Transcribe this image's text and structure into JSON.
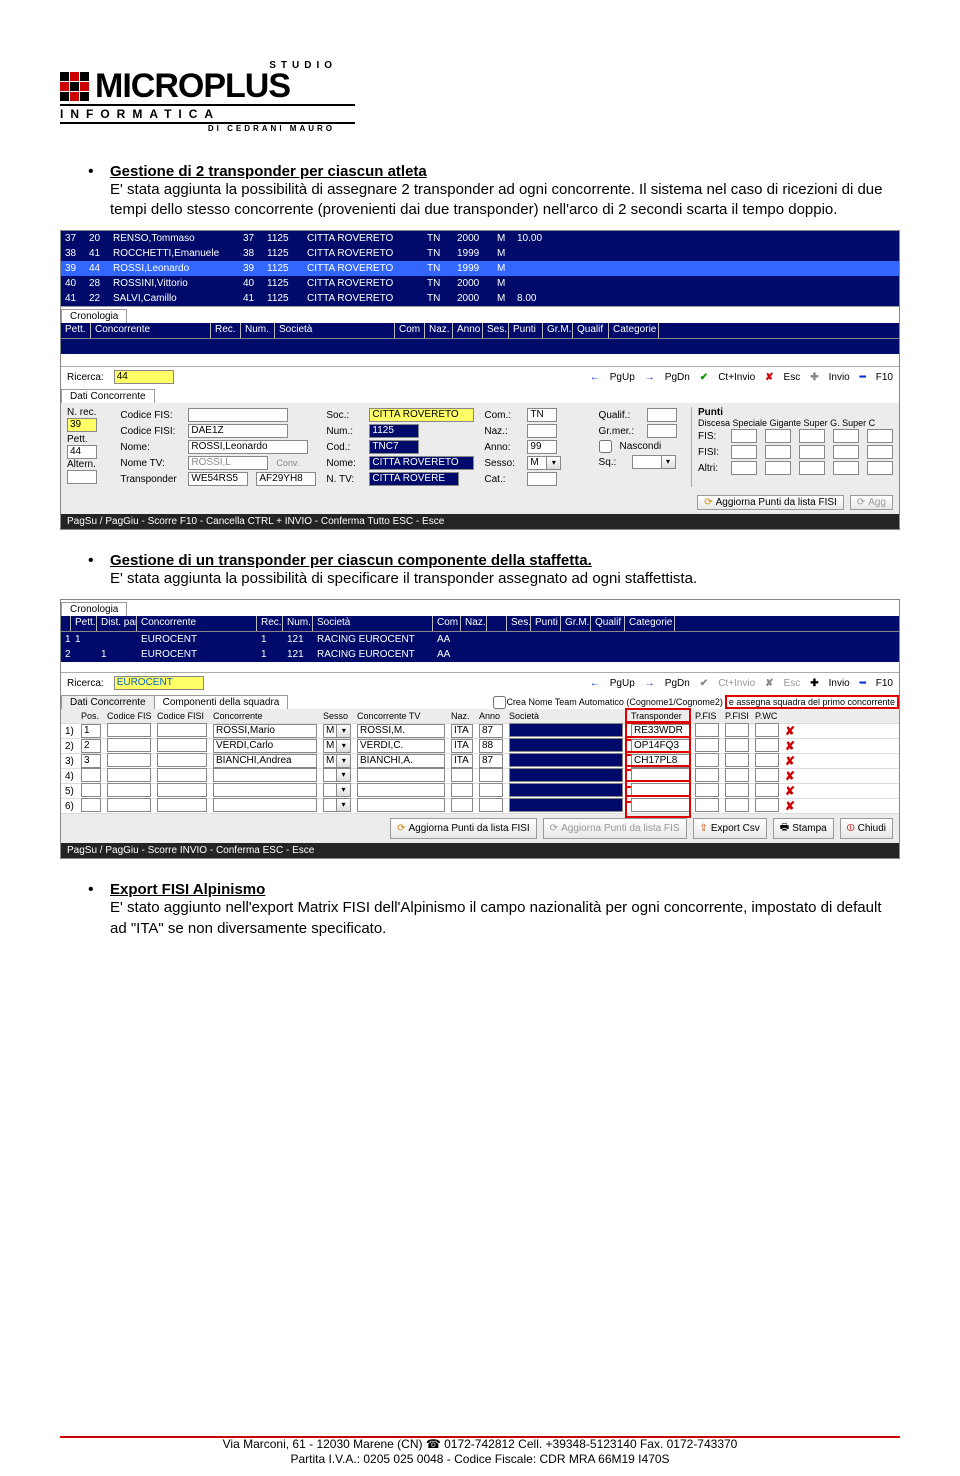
{
  "logo": {
    "studio": "STUDIO",
    "brand": "MICROPLUS",
    "sub1": "INFORMATICA",
    "sub2": "DI CEDRANI MAURO"
  },
  "sections": [
    {
      "title": "Gestione di 2 transponder per ciascun atleta",
      "body": "E' stata aggiunta la possibilità di assegnare 2 transponder ad ogni concorrente. Il sistema nel caso di ricezioni di due tempi dello stesso concorrente (provenienti dai due transponder) nell'arco di 2 secondi scarta il tempo doppio."
    },
    {
      "title": "Gestione di un transponder per ciascun componente della staffetta.",
      "body": "E' stata aggiunta la possibilità di specificare il transponder assegnato ad ogni staffettista."
    },
    {
      "title": "Export FISI Alpinismo",
      "body": "E' stato aggiunto nell'export Matrix FISI dell'Alpinismo il campo nazionalità per ogni concorrente, impostato di default ad \"ITA\" se non diversamente specificato."
    }
  ],
  "shot1": {
    "rows": [
      {
        "c": [
          "37",
          "20",
          "RENSO,Tommaso",
          "37",
          "1125",
          "CITTA ROVERETO",
          "TN",
          "2000",
          "M",
          "10.00"
        ],
        "sel": false
      },
      {
        "c": [
          "38",
          "41",
          "ROCCHETTI,Emanuele",
          "38",
          "1125",
          "CITTA ROVERETO",
          "TN",
          "1999",
          "M",
          ""
        ],
        "sel": false
      },
      {
        "c": [
          "39",
          "44",
          "ROSSI,Leonardo",
          "39",
          "1125",
          "CITTA ROVERETO",
          "TN",
          "1999",
          "M",
          ""
        ],
        "sel": true
      },
      {
        "c": [
          "40",
          "28",
          "ROSSINI,Vittorio",
          "40",
          "1125",
          "CITTA ROVERETO",
          "TN",
          "2000",
          "M",
          ""
        ],
        "sel": false
      },
      {
        "c": [
          "41",
          "22",
          "SALVI,Camillo",
          "41",
          "1125",
          "CITTA ROVERETO",
          "TN",
          "2000",
          "M",
          "8.00"
        ],
        "sel": false
      }
    ],
    "cronologia_tab": "Cronologia",
    "cronologia_headers": [
      "Pett.",
      "Concorrente",
      "Rec.",
      "Num.",
      "Società",
      "Com",
      "Naz.",
      "Anno",
      "Ses.",
      "Punti",
      "Gr.M.",
      "Qualif",
      "Categorie"
    ],
    "ricerca_label": "Ricerca:",
    "ricerca_value": "44",
    "nav": {
      "pgup": "PgUp",
      "pgdn": "PgDn",
      "ctinvio": "Ct+Invio",
      "esc": "Esc",
      "invio": "Invio",
      "f10": "F10"
    },
    "dati_tab": "Dati Concorrente",
    "form": {
      "nrec_label": "N. rec.",
      "nrec": "39",
      "pett_label": "Pett.",
      "pett": "44",
      "altern_label": "Altern.",
      "codfis_label": "Codice FIS:",
      "codfisi_label": "Codice FISI:",
      "codfisi": "DAE1Z",
      "nome_label": "Nome:",
      "nome": "ROSSI,Leonardo",
      "nometv_label": "Nome TV:",
      "nometv": "ROSSI,L",
      "conv_label": "Conv.",
      "transp_label": "Transponder",
      "transp1": "WE54RS5",
      "transp2": "AF29YH8",
      "soc_label": "Soc.:",
      "soc": "CITTA ROVERETO",
      "num_label": "Num.:",
      "num": "1125",
      "cod_label": "Cod.:",
      "cod": "TNC7",
      "nome2_label": "Nome:",
      "nome2": "CITTA ROVERETO",
      "ntv_label": "N. TV:",
      "ntv": "CITTA ROVERE",
      "com_label": "Com.:",
      "com": "TN",
      "naz_label": "Naz.:",
      "anno_label": "Anno:",
      "anno": "99",
      "sesso_label": "Sesso:",
      "sesso": "M",
      "cat_label": "Cat.:",
      "qualif_label": "Qualif.:",
      "grmer_label": "Gr.mer.:",
      "nascondi_label": "Nascondi",
      "sq_label": "Sq.:",
      "punti_title": "Punti",
      "punti_cols": "Discesa Speciale Gigante Super G. Super C",
      "fis_label": "FIS:",
      "fisi_label": "FISI:",
      "altri_label": "Altri:"
    },
    "btn_aggiorna": "Aggiorna Punti da lista FISI",
    "btn_agg": "Agg",
    "statusbar": "PagSu / PagGiu - Scorre      F10 - Cancella   CTRL + INVIO - Conferma Tutto   ESC - Esce"
  },
  "shot2": {
    "cronologia_tab": "Cronologia",
    "headers": [
      "",
      "Pett.",
      "Dist. par.",
      "Concorrente",
      "Rec.",
      "Num.",
      "Società",
      "Com",
      "Naz.",
      "",
      "Ses.",
      "Punti",
      "Gr.M.",
      "Qualif",
      "Categorie"
    ],
    "rows": [
      {
        "c": [
          "1",
          "1",
          "",
          "EUROCENT",
          "1",
          "121",
          "RACING EUROCENT",
          "AA",
          "",
          "",
          "",
          "",
          "",
          "",
          ""
        ],
        "sel": true
      },
      {
        "c": [
          "2",
          "",
          "1",
          "EUROCENT",
          "1",
          "121",
          "RACING EUROCENT",
          "AA",
          "",
          "",
          "",
          "",
          "",
          "",
          ""
        ],
        "sel": false
      }
    ],
    "ricerca_label": "Ricerca:",
    "ricerca_value": "EUROCENT",
    "nav": {
      "pgup": "PgUp",
      "pgdn": "PgDn",
      "ctinvio": "Ct+Invio",
      "esc": "Esc",
      "invio": "Invio",
      "f10": "F10"
    },
    "tab1": "Dati Concorrente",
    "tab2": "Componenti della squadra",
    "chk1": "Crea Nome Team Automatico (Cognome1/Cognome2)",
    "chk2": "e assegna squadra del primo concorrente",
    "componenti_headers": [
      "",
      "Pos.",
      "Codice FIS",
      "Codice FISI",
      "Concorrente",
      "Sesso",
      "Concorrente TV",
      "Naz.",
      "Anno",
      "Società",
      "Transponder",
      "P.FIS",
      "P.FISI",
      "P.WC",
      ""
    ],
    "componenti_rows": [
      {
        "n": "1)",
        "pos": "1",
        "conc": "ROSSI,Mario",
        "sex": "M",
        "tv": "ROSSI,M.",
        "naz": "ITA",
        "anno": "87",
        "tr": "RE33WDR"
      },
      {
        "n": "2)",
        "pos": "2",
        "conc": "VERDI,Carlo",
        "sex": "M",
        "tv": "VERDI,C.",
        "naz": "ITA",
        "anno": "88",
        "tr": "OP14FQ3"
      },
      {
        "n": "3)",
        "pos": "3",
        "conc": "BIANCHI,Andrea",
        "sex": "M",
        "tv": "BIANCHI,A.",
        "naz": "ITA",
        "anno": "87",
        "tr": "CH17PL8"
      },
      {
        "n": "4)",
        "pos": "",
        "conc": "",
        "sex": "",
        "tv": "",
        "naz": "",
        "anno": "",
        "tr": ""
      },
      {
        "n": "5)",
        "pos": "",
        "conc": "",
        "sex": "",
        "tv": "",
        "naz": "",
        "anno": "",
        "tr": ""
      },
      {
        "n": "6)",
        "pos": "",
        "conc": "",
        "sex": "",
        "tv": "",
        "naz": "",
        "anno": "",
        "tr": ""
      }
    ],
    "btns": {
      "agg_fisi": "Aggiorna Punti da lista FISI",
      "agg_fis": "Aggiorna Punti da lista FIS",
      "export": "Export Csv",
      "stampa": "Stampa",
      "chiudi": "Chiudi"
    },
    "statusbar": "PagSu / PagGiu - Scorre      INVIO - Conferma    ESC - Esce"
  },
  "footer": {
    "line1_a": "Via Marconi, 61 - 12030 Marene (CN) ",
    "line1_b": " 0172-742812 Cell. +39348-5123140 Fax. 0172-743370",
    "line2": "Partita I.V.A.: 0205 025 0048 - Codice Fiscale: CDR MRA 66M19 I470S"
  }
}
